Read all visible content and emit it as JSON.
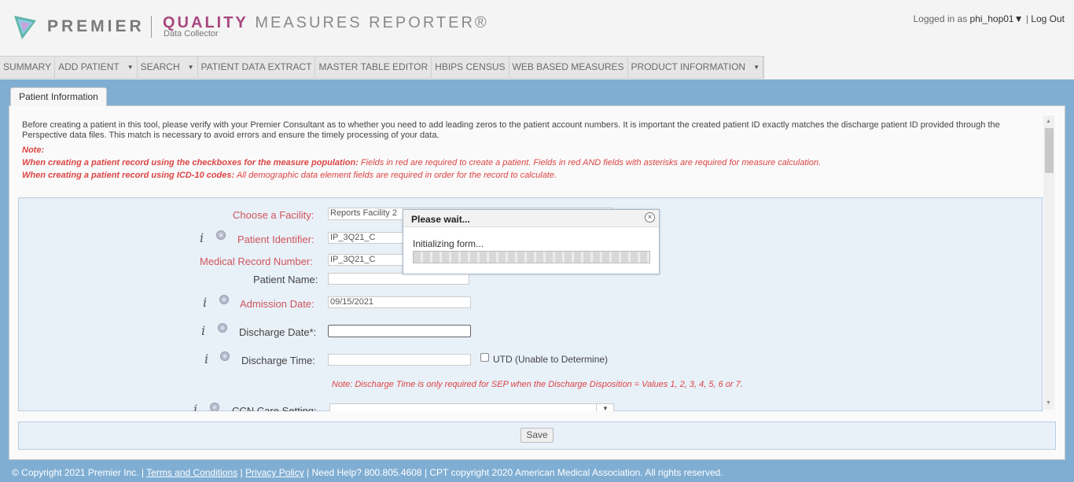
{
  "header": {
    "brand": "PREMIER",
    "product_q": "QUALITY",
    "product_rest": "MEASURES REPORTER®",
    "product_sub": "Data Collector",
    "logged_in_prefix": "Logged in as",
    "username": "phi_hop01▼",
    "separator": "|",
    "logout": "Log Out"
  },
  "nav": [
    {
      "label": "SUMMARY",
      "dropdown": false
    },
    {
      "label": "ADD PATIENT",
      "dropdown": true
    },
    {
      "label": "SEARCH",
      "dropdown": true
    },
    {
      "label": "PATIENT DATA EXTRACT",
      "dropdown": false
    },
    {
      "label": "MASTER TABLE EDITOR",
      "dropdown": false
    },
    {
      "label": "HBIPS CENSUS",
      "dropdown": false
    },
    {
      "label": "WEB BASED MEASURES",
      "dropdown": false
    },
    {
      "label": "PRODUCT INFORMATION",
      "dropdown": true
    }
  ],
  "tab": {
    "label": "Patient Information"
  },
  "notice": {
    "text": "Before creating a patient in this tool, please verify with your Premier Consultant as to whether you need to add leading zeros to the patient account numbers. It is important the created patient ID exactly matches the discharge patient ID provided through the Perspective data files. This match is necessary to avoid errors and ensure the timely processing of your data.",
    "note_label": "Note:",
    "rule1_bold": "When creating a patient record using the checkboxes for the measure population:",
    "rule1_text": " Fields in red are required to create a patient. Fields in red AND fields with asterisks are required for measure calculation.",
    "rule2_bold": "When creating a patient record using ICD-10 codes:",
    "rule2_text": " All demographic data element fields are required in order for the record to calculate."
  },
  "form": {
    "facility_label": "Choose a Facility:",
    "facility_value": "Reports Facility 2",
    "patient_id_label": "Patient Identifier:",
    "patient_id_value": "IP_3Q21_C",
    "mrn_label": "Medical Record Number:",
    "mrn_value": "IP_3Q21_C",
    "patient_name_label": "Patient Name:",
    "patient_name_value": "",
    "admission_label": "Admission Date:",
    "admission_value": "09/15/2021",
    "discharge_date_label": "Discharge Date*:",
    "discharge_date_value": "",
    "discharge_time_label": "Discharge Time:",
    "discharge_time_value": "",
    "utd_label": "UTD (Unable to Determine)",
    "discharge_time_note": "Note: Discharge Time is only required for SEP when the Discharge Disposition = Values 1, 2, 3, 4, 5, 6 or 7.",
    "ccn_label": "CCN Care Setting:",
    "info_glyph": "i"
  },
  "save_label": "Save",
  "dialog": {
    "title": "Please wait...",
    "message": "Initializing form...",
    "close_glyph": "×"
  },
  "footer": {
    "copyright": "© Copyright 2021 Premier Inc.  | ",
    "terms": "Terms and Conditions",
    "sep1": " | ",
    "privacy": "Privacy Policy",
    "rest": " | Need Help? 800.805.4608 | CPT copyright 2020 American Medical Association. All rights reserved."
  },
  "colors": {
    "page_bg": "#80aed3",
    "required_label": "#d0555b",
    "brand_accent": "#a8477e"
  }
}
